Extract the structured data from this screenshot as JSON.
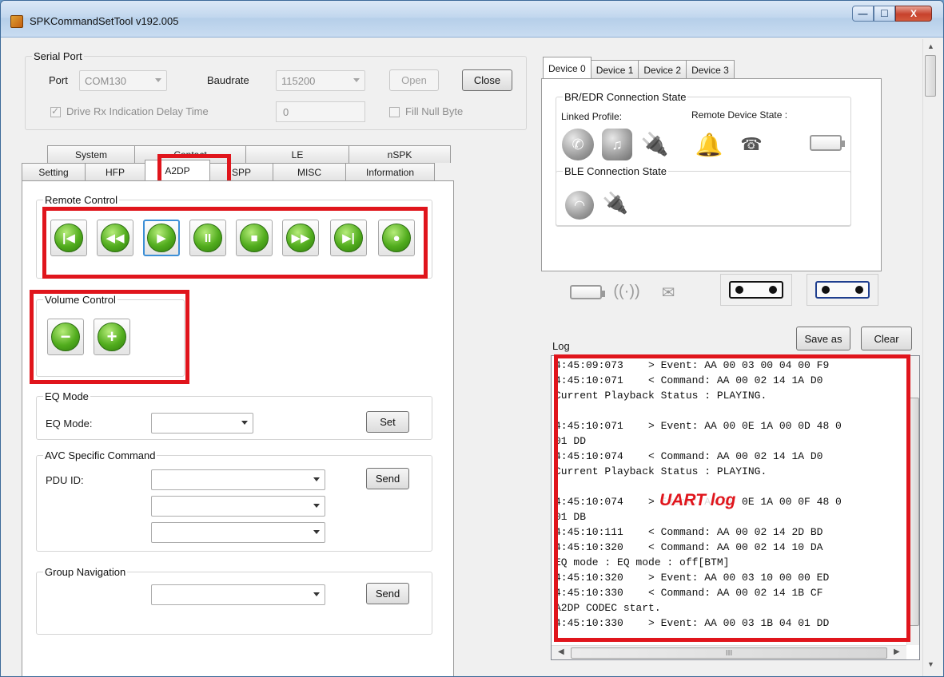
{
  "window": {
    "title": "SPKCommandSetTool v192.005",
    "min": "—",
    "max": "☐",
    "close": "X"
  },
  "serial": {
    "legend": "Serial Port",
    "port_label": "Port",
    "port_value": "COM130",
    "baud_label": "Baudrate",
    "baud_value": "115200",
    "open": "Open",
    "close": "Close",
    "drive_rx_label": "Drive Rx Indication Delay Time",
    "drive_rx_value": "0",
    "fill_null_label": "Fill Null Byte"
  },
  "tabs_top": [
    "System",
    "Contact",
    "LE",
    "nSPK"
  ],
  "tabs_bottom": [
    "Setting",
    "HFP",
    "A2DP",
    "SPP",
    "MISC",
    "Information"
  ],
  "remote": {
    "legend": "Remote Control"
  },
  "volume": {
    "legend": "Volume Control",
    "minus": "−",
    "plus": "+"
  },
  "eq": {
    "legend": "EQ Mode",
    "label": "EQ Mode:",
    "value": "",
    "set": "Set"
  },
  "avc": {
    "legend": "AVC Specific Command",
    "label": "PDU ID:",
    "send": "Send"
  },
  "group": {
    "legend": "Group Navigation",
    "send": "Send"
  },
  "device": {
    "tabs": [
      "Device 0",
      "Device 1",
      "Device 2",
      "Device 3"
    ],
    "br_legend": "BR/EDR Connection State",
    "linked_profile": "Linked Profile:",
    "remote_state": "Remote Device State :",
    "ble_legend": "BLE Connection State"
  },
  "log": {
    "label": "Log",
    "save_as": "Save as",
    "clear": "Clear",
    "annotation": "UART log",
    "lines": [
      "4:45:09:073    > Event: AA 00 03 00 04 00 F9",
      "4:45:10:071    < Command: AA 00 02 14 1A D0",
      "Current Playback Status : PLAYING.",
      "",
      "4:45:10:071    > Event: AA 00 0E 1A 00 0D 48 0",
      "01 DD",
      "4:45:10:074    < Command: AA 00 02 14 1A D0",
      "Current Playback Status : PLAYING.",
      "",
      "4:45:10:074    > Event: AA 00 0E 1A 00 0F 48 0",
      "01 DB",
      "4:45:10:111    < Command: AA 00 02 14 2D BD",
      "4:45:10:320    < Command: AA 00 02 14 10 DA",
      "EQ mode : EQ mode : off[BTM]",
      "4:45:10:320    > Event: AA 00 03 10 00 00 ED",
      "4:45:10:330    < Command: AA 00 02 14 1B CF",
      "A2DP CODEC start.",
      "4:45:10:330    > Event: AA 00 03 1B 04 01 DD"
    ],
    "hscroll_thumb": "III"
  }
}
